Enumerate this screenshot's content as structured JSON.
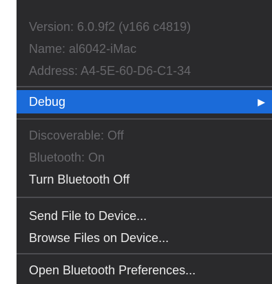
{
  "menu": {
    "info": {
      "version": "Version: 6.0.9f2 (v166 c4819)",
      "name": "Name: al6042-iMac",
      "address": "Address: A4-5E-60-D6-C1-34"
    },
    "debug": {
      "label": "Debug",
      "submenu_arrow": "▶"
    },
    "status": {
      "discoverable": "Discoverable: Off",
      "bluetooth": "Bluetooth: On"
    },
    "turn_off_label": "Turn Bluetooth Off",
    "send_file_label": "Send File to Device...",
    "browse_files_label": "Browse Files on Device...",
    "open_prefs_label": "Open Bluetooth Preferences..."
  },
  "colors": {
    "menu_background": "#2a2a2c",
    "highlight": "#1b6bd9",
    "disabled_text": "#67676b",
    "enabled_text": "#ececec"
  }
}
